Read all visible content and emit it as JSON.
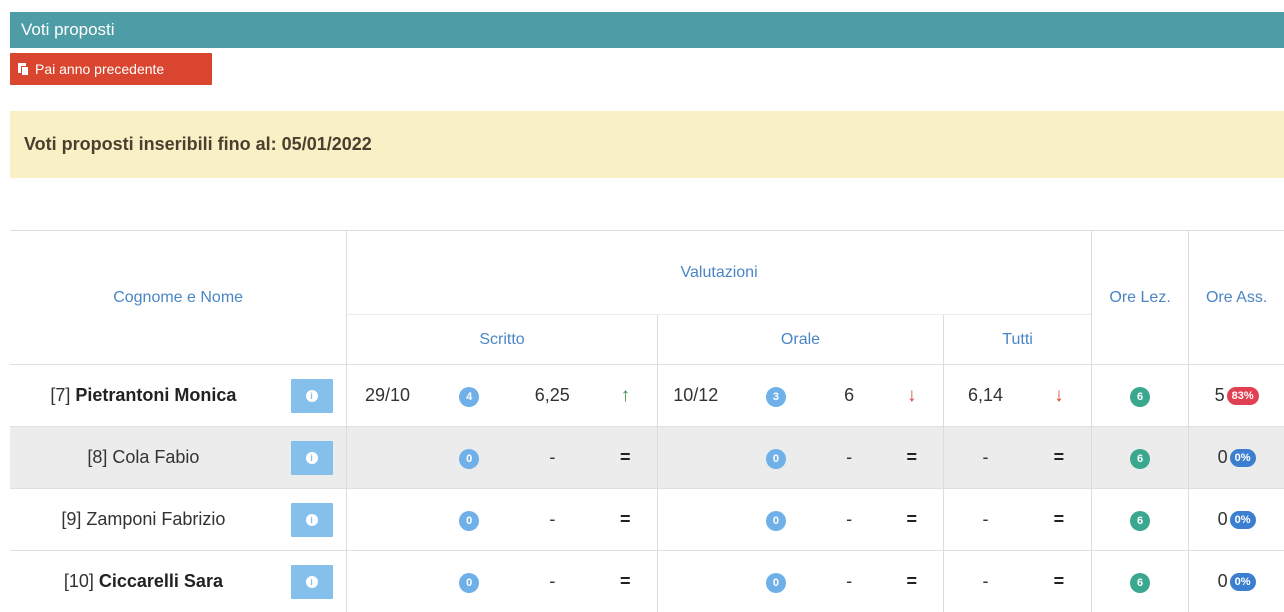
{
  "page": {
    "title": "Voti proposti",
    "pai_button_label": "Pai anno precedente",
    "banner_text": "Voti proposti inseribili fino al: 05/01/2022"
  },
  "table": {
    "headers": {
      "name": "Cognome e Nome",
      "valutazioni": "Valutazioni",
      "scritto": "Scritto",
      "orale": "Orale",
      "tutti": "Tutti",
      "ore_lez": "Ore Lez.",
      "ore_ass": "Ore Ass."
    },
    "rows": [
      {
        "num": "[7]",
        "name": "Pietrantoni Monica",
        "bold": true,
        "scritto_date": "29/10",
        "scritto_count": "4",
        "scritto_avg": "6,25",
        "scritto_trend": "↑",
        "orale_date": "10/12",
        "orale_count": "3",
        "orale_avg": "6",
        "orale_trend": "↓",
        "tutti_avg": "6,14",
        "tutti_trend": "↓",
        "ore_lez": "6",
        "ore_ass": "5",
        "ore_ass_pct": "83%"
      },
      {
        "num": "[8]",
        "name": "Cola Fabio",
        "bold": false,
        "scritto_date": "",
        "scritto_count": "0",
        "scritto_avg": "-",
        "scritto_trend": "=",
        "orale_date": "",
        "orale_count": "0",
        "orale_avg": "-",
        "orale_trend": "=",
        "tutti_avg": "-",
        "tutti_trend": "=",
        "ore_lez": "6",
        "ore_ass": "0",
        "ore_ass_pct": "0%"
      },
      {
        "num": "[9]",
        "name": "Zamponi Fabrizio",
        "bold": false,
        "scritto_date": "",
        "scritto_count": "0",
        "scritto_avg": "-",
        "scritto_trend": "=",
        "orale_date": "",
        "orale_count": "0",
        "orale_avg": "-",
        "orale_trend": "=",
        "tutti_avg": "-",
        "tutti_trend": "=",
        "ore_lez": "6",
        "ore_ass": "0",
        "ore_ass_pct": "0%"
      },
      {
        "num": "[10]",
        "name": "Ciccarelli Sara",
        "bold": true,
        "scritto_date": "",
        "scritto_count": "0",
        "scritto_avg": "-",
        "scritto_trend": "=",
        "orale_date": "",
        "orale_count": "0",
        "orale_avg": "-",
        "orale_trend": "=",
        "tutti_avg": "-",
        "tutti_trend": "=",
        "ore_lez": "6",
        "ore_ass": "0",
        "ore_ass_pct": "0%"
      }
    ]
  },
  "icons": {
    "copy": "copy-icon",
    "info": "info-icon"
  },
  "colors": {
    "titlebar": "#4e9ca6",
    "pai_button": "#d9452f",
    "banner": "#f9f1c5",
    "header_text": "#4a86c5",
    "badge_blue": "#6fb0e8",
    "badge_green": "#3aa88e",
    "pct_red": "#e04052",
    "pct_blue": "#3c7fd0",
    "arrow_up": "#3c8a3c",
    "arrow_down": "#d9452f"
  }
}
